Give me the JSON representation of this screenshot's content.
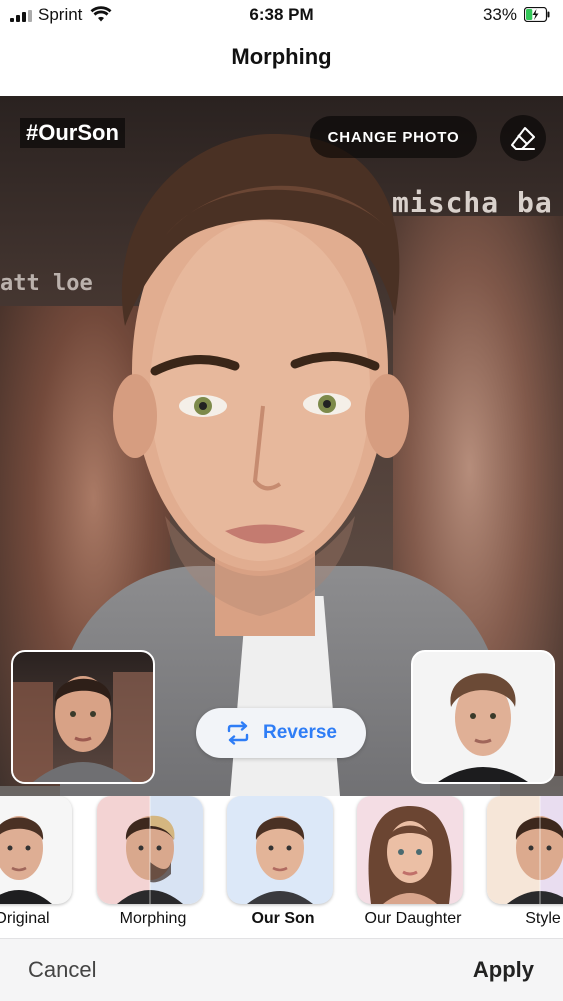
{
  "status_bar": {
    "carrier": "Sprint",
    "time": "6:38 PM",
    "battery_percent": "33%",
    "battery_level": 0.33,
    "icons": [
      "signal-icon",
      "wifi-icon",
      "battery-charging-icon"
    ]
  },
  "header": {
    "title": "Morphing"
  },
  "photo": {
    "hashtag": "#OurSon",
    "change_photo_label": "CHANGE PHOTO",
    "eraser_icon": "eraser-icon",
    "poster_text_1": "mischa ba",
    "poster_text_2": "att loe",
    "reverse_label": "Reverse",
    "reverse_icon": "swap-arrows-icon"
  },
  "styles": {
    "items": [
      {
        "label": "Original",
        "active": false
      },
      {
        "label": "Morphing",
        "active": false
      },
      {
        "label": "Our Son",
        "active": true
      },
      {
        "label": "Our Daughter",
        "active": false
      },
      {
        "label": "Style",
        "active": false
      }
    ]
  },
  "footer": {
    "cancel_label": "Cancel",
    "apply_label": "Apply"
  },
  "colors": {
    "accent": "#2f7df6",
    "battery_green": "#34c759",
    "pill_dark": "rgba(0,0,0,0.55)"
  }
}
